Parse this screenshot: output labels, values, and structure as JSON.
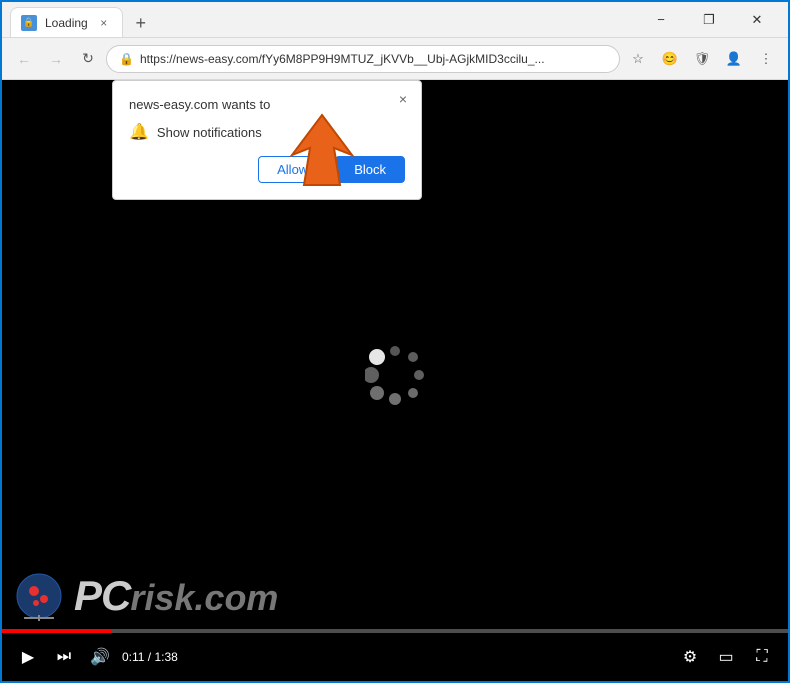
{
  "window": {
    "title": "Loading",
    "url": "https://news-easy.com/fYy6M8PP9H9MTUZ_jKVVb__Ubj-AGjkMID3ccilu_...",
    "controls": {
      "minimize": "−",
      "restore": "❐",
      "close": "✕"
    }
  },
  "nav": {
    "back_label": "←",
    "forward_label": "→",
    "reload_label": "↻"
  },
  "popup": {
    "title": "news-easy.com wants to",
    "description": "Show notifications",
    "close_label": "×",
    "allow_label": "Allow",
    "block_label": "Block"
  },
  "video": {
    "time_current": "0:11",
    "time_total": "1:38",
    "time_display": "0:11 / 1:38",
    "progress_percent": 14
  },
  "spinner": {
    "dots": [
      {
        "angle": 0,
        "color": "#555",
        "size": 12
      },
      {
        "angle": 45,
        "color": "#666",
        "size": 12
      },
      {
        "angle": 90,
        "color": "#777",
        "size": 12
      },
      {
        "angle": 135,
        "color": "#999",
        "size": 12
      },
      {
        "angle": 180,
        "color": "#bbb",
        "size": 12
      },
      {
        "angle": 225,
        "color": "#ddd",
        "size": 14
      },
      {
        "angle": 270,
        "color": "#eee",
        "size": 16
      },
      {
        "angle": 315,
        "color": "#fff",
        "size": 16
      }
    ]
  }
}
